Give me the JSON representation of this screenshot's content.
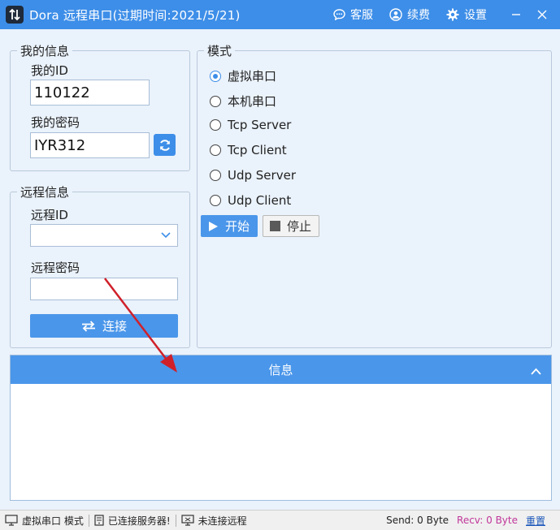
{
  "window": {
    "title": "Dora 远程串口(过期时间:2021/5/21)",
    "actions": [
      {
        "label": "客服",
        "icon": "chat-icon"
      },
      {
        "label": "续费",
        "icon": "user-icon"
      },
      {
        "label": "设置",
        "icon": "gear-icon"
      }
    ]
  },
  "my_info": {
    "legend": "我的信息",
    "id_label": "我的ID",
    "id_value": "110122",
    "password_label": "我的密码",
    "password_value": "IYR312"
  },
  "remote_info": {
    "legend": "远程信息",
    "id_label": "远程ID",
    "id_value": "",
    "password_label": "远程密码",
    "password_value": "",
    "connect_label": "连接"
  },
  "mode": {
    "legend": "模式",
    "options": [
      {
        "label": "虚拟串口",
        "checked": true
      },
      {
        "label": "本机串口",
        "checked": false
      },
      {
        "label": "Tcp Server",
        "checked": false
      },
      {
        "label": "Tcp Client",
        "checked": false
      },
      {
        "label": "Udp Server",
        "checked": false
      },
      {
        "label": "Udp Client",
        "checked": false
      }
    ],
    "start_label": "开始",
    "stop_label": "停止"
  },
  "info_panel": {
    "title": "信息",
    "content": ""
  },
  "statusbar": {
    "mode_text": "虚拟串口 模式",
    "server_text": "已连接服务器!",
    "remote_text": "未连接远程",
    "send_text": "Send: 0 Byte",
    "recv_text": "Recv: 0 Byte",
    "reset_label": "重置"
  },
  "colors": {
    "accent": "#3d8ee8",
    "arrow": "#d0202a",
    "recv": "#c0369a"
  }
}
